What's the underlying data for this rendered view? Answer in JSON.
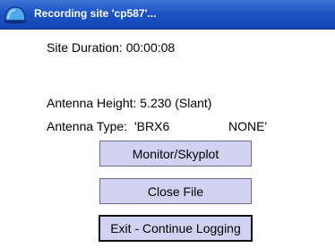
{
  "window": {
    "title": "Recording site 'cp587'...",
    "icon": "app-globe-icon"
  },
  "info": {
    "site_duration": "Site Duration: 00:00:08",
    "antenna_height": "Antenna Height: 5.230 (Slant)",
    "antenna_type_label": "Antenna Type:",
    "antenna_type_value": "'BRX6",
    "antenna_type_radome": "NONE'"
  },
  "buttons": {
    "monitor": "Monitor/Skyplot",
    "close_file": "Close File",
    "exit": "Exit - Continue Logging"
  },
  "colors": {
    "titlebar": "#1d54c4",
    "button_face": "#cfd3f1"
  }
}
